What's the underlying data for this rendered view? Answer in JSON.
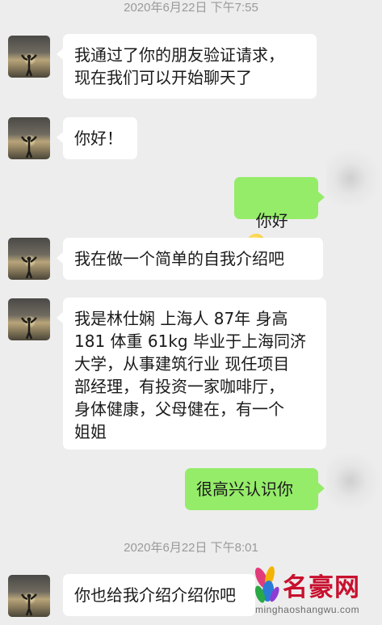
{
  "chat": {
    "timestamp_1": "2020年6月22日 下午7:55",
    "timestamp_2": "2020年6月22日 下午8:01",
    "messages": [
      {
        "side": "left",
        "text": "我通过了你的朋友验证请求，\n现在我们可以开始聊天了"
      },
      {
        "side": "left",
        "text": "你好！"
      },
      {
        "side": "right",
        "text": "你好",
        "emoji": "smiling-face-emoji"
      },
      {
        "side": "left",
        "text": "我在做一个简单的自我介绍吧"
      },
      {
        "side": "left",
        "text": "我是林仕娴 上海人 87年 身高\n181 体重 61kg 毕业于上海同济\n大学，从事建筑行业 现任项目\n部经理，有投资一家咖啡厅，\n身体健康，父母健在，有一个\n姐姐"
      },
      {
        "side": "right",
        "text": "很高兴认识你"
      },
      {
        "side": "left",
        "text": "你也给我介绍介绍你吧"
      }
    ]
  },
  "watermark": {
    "title": "名豪网",
    "url": "minghaoshangwu.com"
  },
  "colors": {
    "background": "#ededed",
    "outgoing_bubble": "#95ec69",
    "incoming_bubble": "#ffffff",
    "timestamp": "#9a9a9a",
    "watermark_red": "#c8102e"
  }
}
